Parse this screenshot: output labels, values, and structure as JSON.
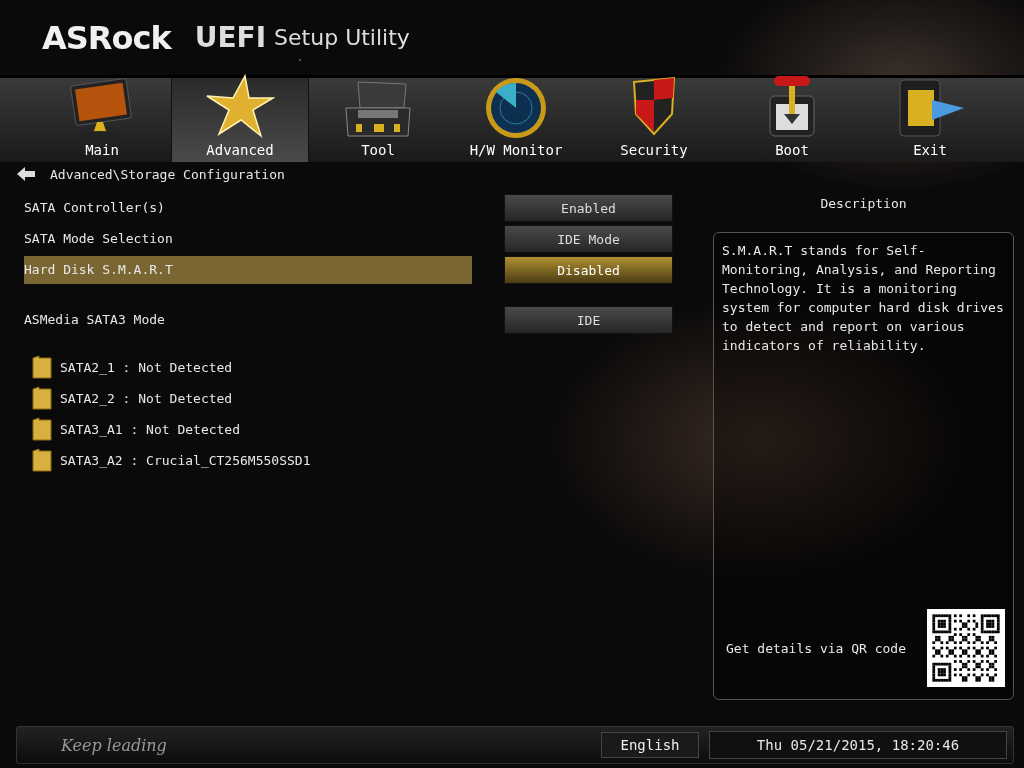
{
  "header": {
    "brand": "ASRock",
    "product": "UEFI",
    "subtitle": "Setup Utility"
  },
  "tabs": [
    {
      "label": "Main",
      "kind": "monitor",
      "selected": false
    },
    {
      "label": "Advanced",
      "kind": "star",
      "selected": true
    },
    {
      "label": "Tool",
      "kind": "toolbox",
      "selected": false
    },
    {
      "label": "H/W Monitor",
      "kind": "radar",
      "selected": false
    },
    {
      "label": "Security",
      "kind": "shield",
      "selected": false
    },
    {
      "label": "Boot",
      "kind": "joystick",
      "selected": false
    },
    {
      "label": "Exit",
      "kind": "exit",
      "selected": false
    }
  ],
  "breadcrumb": "Advanced\\Storage Configuration",
  "setting_groups": [
    [
      {
        "label": "SATA Controller(s)",
        "value": "Enabled",
        "selected": false
      },
      {
        "label": "SATA Mode Selection",
        "value": "IDE Mode",
        "selected": false
      },
      {
        "label": "Hard Disk S.M.A.R.T",
        "value": "Disabled",
        "selected": true
      }
    ],
    [
      {
        "label": "ASMedia SATA3 Mode",
        "value": "IDE",
        "selected": false
      }
    ]
  ],
  "devices": [
    {
      "label": "SATA2_1 : Not Detected"
    },
    {
      "label": "SATA2_2 : Not Detected"
    },
    {
      "label": "SATA3_A1 : Not Detected"
    },
    {
      "label": "SATA3_A2 : Crucial_CT256M550SSD1"
    }
  ],
  "description": {
    "title": "Description",
    "text": "S.M.A.R.T stands for Self-Monitoring, Analysis, and Reporting Technology. It is a monitoring system for computer hard disk drives to detect and report on various indicators of reliability.",
    "qr_caption": "Get details via QR code"
  },
  "footer": {
    "slogan": "Keep leading",
    "language": "English",
    "datetime": "Thu 05/21/2015, 18:20:46"
  }
}
